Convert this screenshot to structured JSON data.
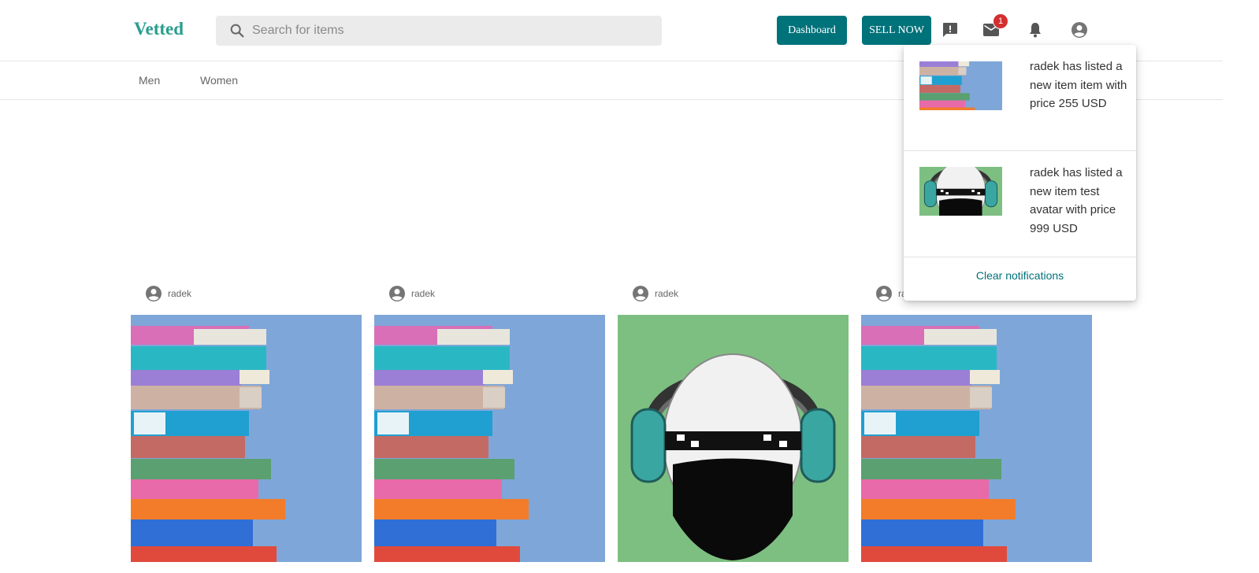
{
  "header": {
    "logo": "Vetted",
    "search_placeholder": "Search for items",
    "dashboard_label": "Dashboard",
    "sell_label": "SELL NOW",
    "mail_badge": "1"
  },
  "nav": {
    "categories": [
      "Men",
      "Women"
    ]
  },
  "products": [
    {
      "seller": "radek",
      "image": "books"
    },
    {
      "seller": "radek",
      "image": "books"
    },
    {
      "seller": "radek",
      "image": "headphones-avatar"
    },
    {
      "seller": "ra",
      "image": "books"
    }
  ],
  "notifications": {
    "items": [
      {
        "text": "radek has listed a new item item with price 255 USD",
        "image": "books"
      },
      {
        "text": "radek has listed a new item test avatar with price 999 USD",
        "image": "headphones-avatar"
      }
    ],
    "clear_label": "Clear notifications"
  },
  "colors": {
    "brand": "#2a9d8f",
    "button": "#00727a",
    "badge": "#d32f2f"
  }
}
